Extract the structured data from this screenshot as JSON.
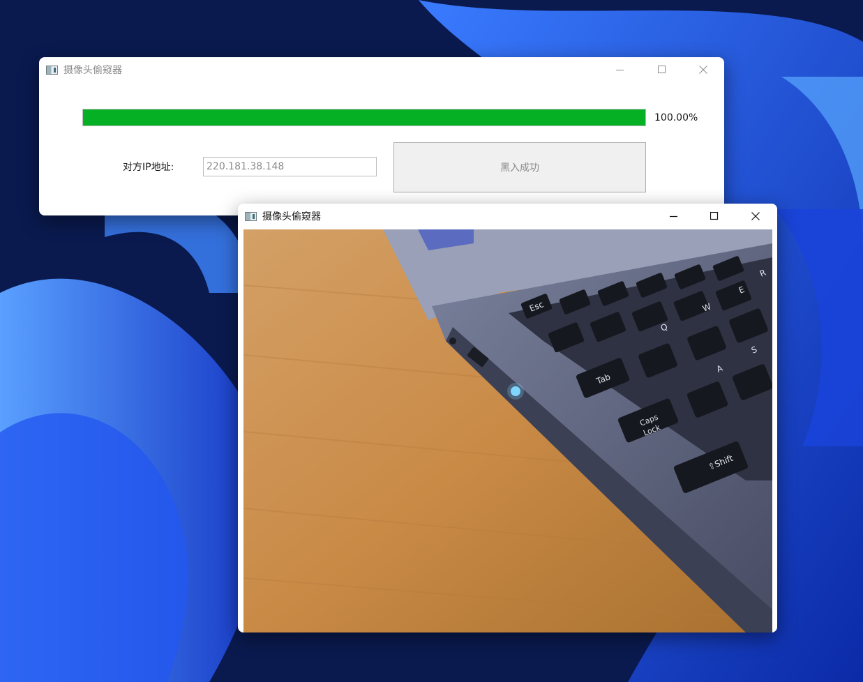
{
  "main_window": {
    "title": "摄像头偷窥器",
    "progress": {
      "value_percent": 100,
      "text": "100.00%",
      "color": "#06b025"
    },
    "ip_label": "对方IP地址:",
    "ip_value": "220.181.38.148",
    "hack_button_label": "黑入成功"
  },
  "camera_window": {
    "title": "摄像头偷窥器",
    "feed_description_keys": [
      "Esc",
      "Tab",
      "Caps Lock",
      "Shift",
      "Q",
      "W",
      "E",
      "R",
      "A",
      "S"
    ]
  },
  "window_controls": {
    "minimize_icon": "minimize-icon",
    "maximize_icon": "maximize-icon",
    "close_icon": "close-icon"
  },
  "colors": {
    "wallpaper_accent": "#1a3fd6",
    "desk": "#c98a46",
    "laptop": "#5a607a"
  }
}
